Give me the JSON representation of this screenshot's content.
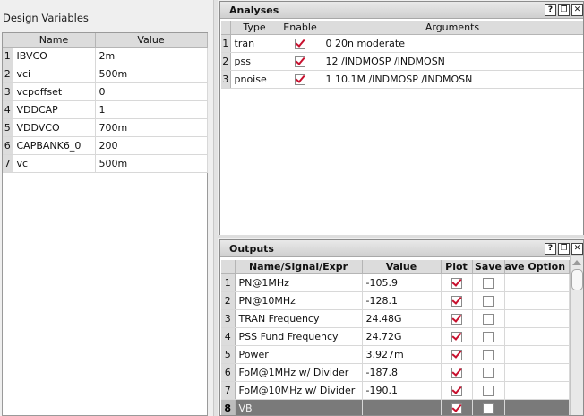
{
  "design_variables": {
    "title": "Design Variables",
    "columns": [
      "Name",
      "Value"
    ],
    "rows": [
      {
        "num": "1",
        "name": "IBVCO",
        "value": "2m"
      },
      {
        "num": "2",
        "name": "vci",
        "value": "500m"
      },
      {
        "num": "3",
        "name": "vcpoffset",
        "value": "0"
      },
      {
        "num": "4",
        "name": "VDDCAP",
        "value": "1"
      },
      {
        "num": "5",
        "name": "VDDVCO",
        "value": "700m"
      },
      {
        "num": "6",
        "name": "CAPBANK6_0",
        "value": "200"
      },
      {
        "num": "7",
        "name": "vc",
        "value": "500m"
      }
    ]
  },
  "analyses": {
    "title": "Analyses",
    "columns": [
      "Type",
      "Enable",
      "Arguments"
    ],
    "rows": [
      {
        "num": "1",
        "type": "tran",
        "enabled": true,
        "arguments": "0 20n moderate"
      },
      {
        "num": "2",
        "type": "pss",
        "enabled": true,
        "arguments": "12 /INDMOSP /INDMOSN"
      },
      {
        "num": "3",
        "type": "pnoise",
        "enabled": true,
        "arguments": " 1 10.1M /INDMOSP /INDMOSN"
      }
    ]
  },
  "outputs": {
    "title": "Outputs",
    "columns": [
      "Name/Signal/Expr",
      "Value",
      "Plot",
      "Save",
      "ave Option"
    ],
    "rows": [
      {
        "num": "1",
        "name": "PN@1MHz",
        "value": "-105.9",
        "plot": true,
        "save": false
      },
      {
        "num": "2",
        "name": "PN@10MHz",
        "value": "-128.1",
        "plot": true,
        "save": false
      },
      {
        "num": "3",
        "name": "TRAN Frequency",
        "value": "24.48G",
        "plot": true,
        "save": false
      },
      {
        "num": "4",
        "name": "PSS Fund Frequency",
        "value": "24.72G",
        "plot": true,
        "save": false
      },
      {
        "num": "5",
        "name": "Power",
        "value": "3.927m",
        "plot": true,
        "save": false
      },
      {
        "num": "6",
        "name": "FoM@1MHz w/ Divider",
        "value": "-187.8",
        "plot": true,
        "save": false
      },
      {
        "num": "7",
        "name": "FoM@10MHz w/ Divider",
        "value": "-190.1",
        "plot": true,
        "save": false
      },
      {
        "num": "8",
        "name": "VB",
        "value": "",
        "plot": true,
        "save": false,
        "selected": true
      }
    ]
  },
  "title_buttons": {
    "help": "?",
    "float": "❐",
    "close": "✕"
  },
  "colors": {
    "check": "#c8102e",
    "selected_row": "#7a7a7a"
  }
}
